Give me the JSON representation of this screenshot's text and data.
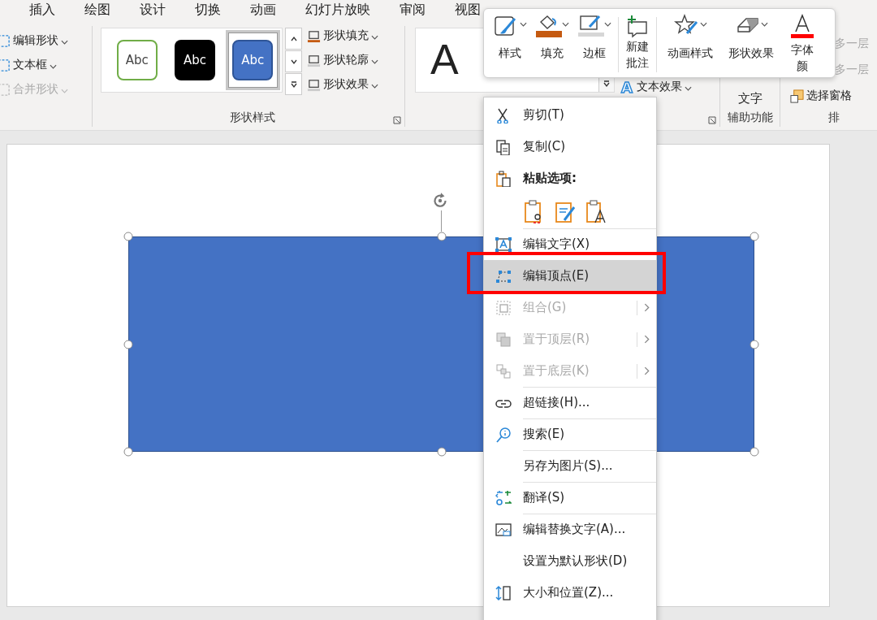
{
  "tabs": [
    {
      "label": "插入"
    },
    {
      "label": "绘图"
    },
    {
      "label": "设计"
    },
    {
      "label": "切换"
    },
    {
      "label": "动画"
    },
    {
      "label": "幻灯片放映"
    },
    {
      "label": "审阅"
    },
    {
      "label": "视图"
    }
  ],
  "ribbon": {
    "insert_shapes": [
      {
        "label": "编辑形状",
        "disabled": false
      },
      {
        "label": "文本框",
        "disabled": false
      },
      {
        "label": "合并形状",
        "disabled": true
      }
    ],
    "style_gallery": [
      {
        "label": "Abc",
        "kind": "outline",
        "selected": false
      },
      {
        "label": "Abc",
        "kind": "dark",
        "selected": false
      },
      {
        "label": "Abc",
        "kind": "blue",
        "selected": true
      }
    ],
    "shape_format": [
      {
        "label": "形状填充"
      },
      {
        "label": "形状轮廓"
      },
      {
        "label": "形状效果"
      }
    ],
    "shape_styles_label": "形状样式",
    "wordart_sample": "A",
    "text_effects_glyph": "A",
    "text_effects": "文本效果",
    "alt_text": "文字",
    "accessibility_label": "辅助功能",
    "arrange": [
      {
        "label": "多一层",
        "disabled": true
      },
      {
        "label": "多一层",
        "disabled": true
      },
      {
        "label": "选择窗格",
        "disabled": false
      }
    ],
    "arrange_label": "排"
  },
  "mini_toolbar": [
    {
      "label": "样式",
      "dropdown": true
    },
    {
      "label": "填充",
      "dropdown": true
    },
    {
      "label": "边框",
      "dropdown": true
    },
    {
      "label": "新建批注",
      "dropdown": false
    },
    {
      "label": "动画样式",
      "dropdown": true
    },
    {
      "label": "形状效果",
      "dropdown": true
    },
    {
      "label": "字体颜",
      "dropdown": false
    }
  ],
  "context_menu": [
    {
      "kind": "item",
      "label": "剪切(T)",
      "disabled": false,
      "submenu": false,
      "selected": false,
      "divider_above": false
    },
    {
      "kind": "item",
      "label": "复制(C)",
      "disabled": false,
      "submenu": false,
      "selected": false,
      "divider_above": false
    },
    {
      "kind": "header",
      "label": "粘贴选项:"
    },
    {
      "kind": "paste"
    },
    {
      "kind": "item",
      "label": "编辑文字(X)",
      "disabled": false,
      "submenu": false,
      "selected": false,
      "divider_above": true
    },
    {
      "kind": "item",
      "label": "编辑顶点(E)",
      "disabled": false,
      "submenu": false,
      "selected": true,
      "divider_above": false
    },
    {
      "kind": "item",
      "label": "组合(G)",
      "disabled": true,
      "submenu": true,
      "selected": false,
      "divider_above": false
    },
    {
      "kind": "item",
      "label": "置于顶层(R)",
      "disabled": true,
      "submenu": true,
      "selected": false,
      "divider_above": false
    },
    {
      "kind": "item",
      "label": "置于底层(K)",
      "disabled": true,
      "submenu": true,
      "selected": false,
      "divider_above": false
    },
    {
      "kind": "item",
      "label": "超链接(H)...",
      "disabled": false,
      "submenu": false,
      "selected": false,
      "divider_above": true
    },
    {
      "kind": "item",
      "label": "搜索(E)",
      "disabled": false,
      "submenu": false,
      "selected": false,
      "divider_above": true
    },
    {
      "kind": "item",
      "label": "另存为图片(S)...",
      "disabled": false,
      "submenu": false,
      "selected": false,
      "divider_above": true
    },
    {
      "kind": "item",
      "label": "翻译(S)",
      "disabled": false,
      "submenu": false,
      "selected": false,
      "divider_above": true
    },
    {
      "kind": "item",
      "label": "编辑替换文字(A)...",
      "disabled": false,
      "submenu": false,
      "selected": false,
      "divider_above": true
    },
    {
      "kind": "item",
      "label": "设置为默认形状(D)",
      "disabled": false,
      "submenu": false,
      "selected": false,
      "divider_above": false
    },
    {
      "kind": "item",
      "label": "大小和位置(Z)...",
      "disabled": false,
      "submenu": false,
      "selected": false,
      "divider_above": false
    }
  ]
}
